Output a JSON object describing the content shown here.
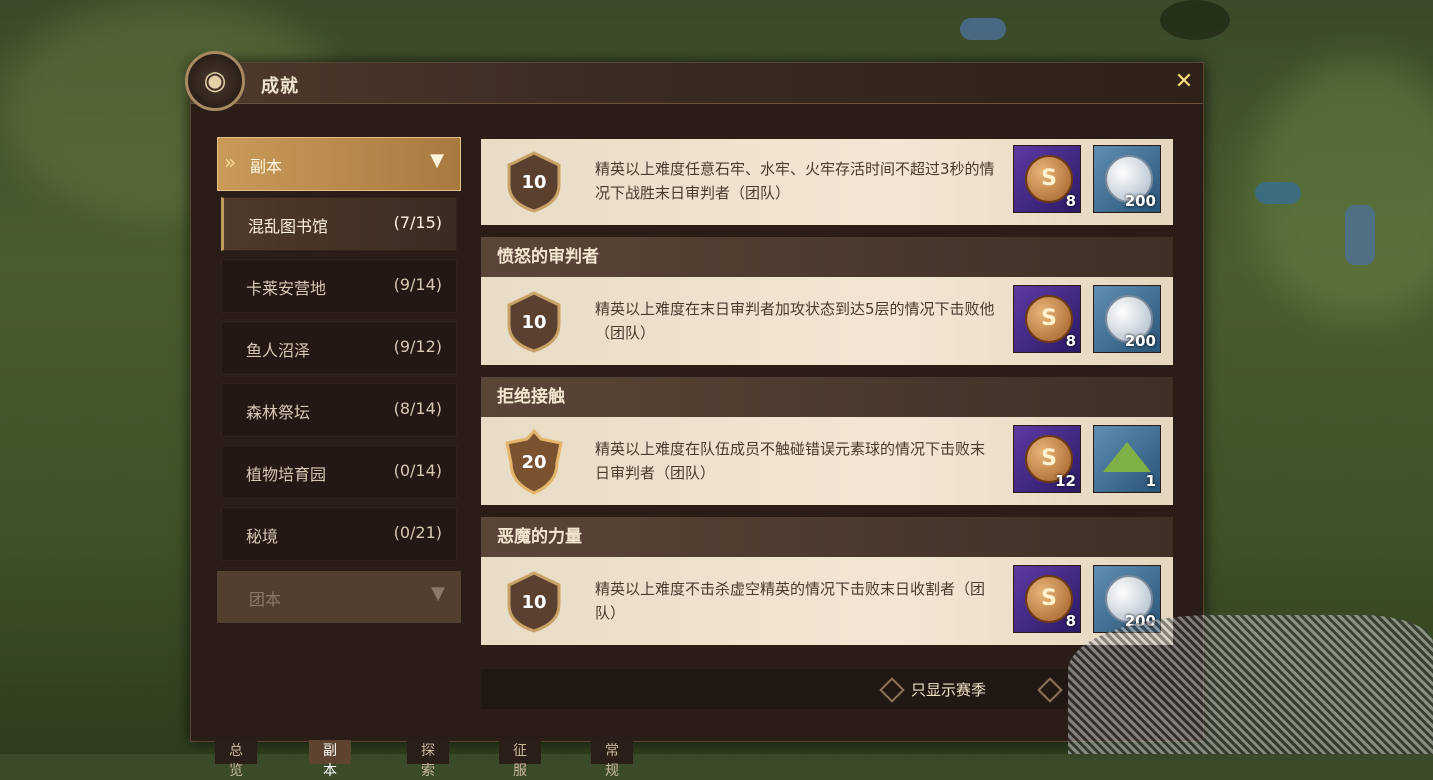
{
  "window": {
    "title": "成就",
    "close_icon": "close-icon"
  },
  "sidebar": {
    "category_top": {
      "label": "副本"
    },
    "items": [
      {
        "label": "混乱图书馆",
        "count": "(7/15)",
        "selected": true
      },
      {
        "label": "卡莱安营地",
        "count": "(9/14)"
      },
      {
        "label": "鱼人沼泽",
        "count": "(9/12)"
      },
      {
        "label": "森林祭坛",
        "count": "(8/14)"
      },
      {
        "label": "植物培育园",
        "count": "(0/14)"
      },
      {
        "label": "秘境",
        "count": "(0/21)"
      }
    ],
    "category_bottom": {
      "label": "团本"
    }
  },
  "achievements": [
    {
      "title": "",
      "points": "10",
      "desc": "精英以上难度任意石牢、水牢、火牢存活时间不超过3秒的情况下战胜末日审判者（团队）",
      "rewards": [
        {
          "icon": "coin-icon",
          "qty": "8"
        },
        {
          "icon": "silver-coin-icon",
          "qty": "200"
        }
      ]
    },
    {
      "title": "愤怒的审判者",
      "points": "10",
      "desc": "精英以上难度在末日审判者加攻状态到达5层的情况下击败他（团队）",
      "rewards": [
        {
          "icon": "coin-icon",
          "qty": "8"
        },
        {
          "icon": "silver-coin-icon",
          "qty": "200"
        }
      ]
    },
    {
      "title": "拒绝接触",
      "points": "20",
      "desc": "精英以上难度在队伍成员不触碰错误元素球的情况下击败末日审判者（团队）",
      "rewards": [
        {
          "icon": "coin-icon",
          "qty": "12"
        },
        {
          "icon": "powder-icon",
          "qty": "1"
        }
      ]
    },
    {
      "title": "恶魔的力量",
      "points": "10",
      "desc": "精英以上难度不击杀虚空精英的情况下击败末日收割者（团队）",
      "rewards": [
        {
          "icon": "coin-icon",
          "qty": "8"
        },
        {
          "icon": "silver-coin-icon",
          "qty": "200"
        }
      ]
    }
  ],
  "footer": {
    "filter_label": "只显示赛季"
  },
  "bottom_tabs": [
    {
      "label": "总览"
    },
    {
      "label": "副本",
      "active": true
    },
    {
      "label": "探索"
    },
    {
      "label": "征服"
    },
    {
      "label": "常规"
    }
  ],
  "colors": {
    "accent": "#c99a58",
    "window_bg": "#2a1d17",
    "card_bg": "#f2e7d4"
  }
}
